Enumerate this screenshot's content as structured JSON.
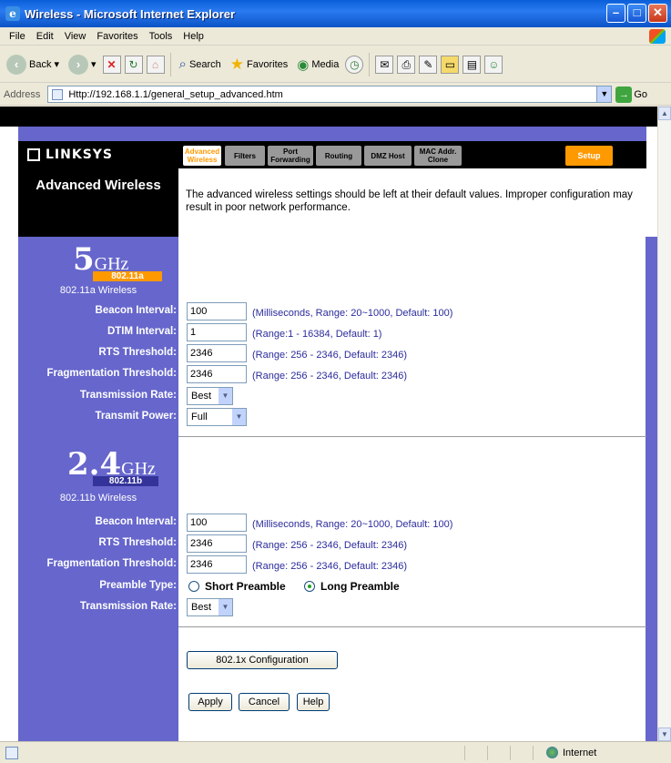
{
  "window": {
    "title": "Wireless - Microsoft Internet Explorer"
  },
  "menu": [
    "File",
    "Edit",
    "View",
    "Favorites",
    "Tools",
    "Help"
  ],
  "toolbar": {
    "back": "Back",
    "search": "Search",
    "favorites": "Favorites",
    "media": "Media"
  },
  "address": {
    "label": "Address",
    "url": "Http://192.168.1.1/general_setup_advanced.htm",
    "go": "Go"
  },
  "brand": {
    "logo": "LINKSYS"
  },
  "tabs": [
    {
      "label": "Advanced Wireless",
      "active": true
    },
    {
      "label": "Filters"
    },
    {
      "label": "Port Forwarding"
    },
    {
      "label": "Routing"
    },
    {
      "label": "DMZ Host"
    },
    {
      "label": "MAC Addr. Clone"
    },
    {
      "label": "Setup"
    }
  ],
  "section": {
    "title": "Advanced Wireless",
    "intro": "The advanced wireless settings should be left at their default values. Improper configuration may result in poor network performance."
  },
  "band_a": {
    "badge_num": "5",
    "badge_unit": "GHz",
    "badge_tag": "802.11a",
    "subtitle": "802.11a Wireless",
    "beacon": {
      "label": "Beacon Interval:",
      "value": "100",
      "hint": "(Milliseconds, Range: 20~1000, Default: 100)"
    },
    "dtim": {
      "label": "DTIM Interval:",
      "value": "1",
      "hint": "(Range:1 - 16384, Default: 1)"
    },
    "rts": {
      "label": "RTS Threshold:",
      "value": "2346",
      "hint": "(Range: 256 - 2346, Default: 2346)"
    },
    "frag": {
      "label": "Fragmentation Threshold:",
      "value": "2346",
      "hint": "(Range: 256 - 2346, Default: 2346)"
    },
    "rate": {
      "label": "Transmission Rate:",
      "value": "Best"
    },
    "power": {
      "label": "Transmit Power:",
      "value": "Full"
    }
  },
  "band_b": {
    "badge_num": "2.4",
    "badge_unit": "GHz",
    "badge_tag": "802.11b",
    "subtitle": "802.11b Wireless",
    "beacon": {
      "label": "Beacon Interval:",
      "value": "100",
      "hint": "(Milliseconds, Range: 20~1000, Default: 100)"
    },
    "rts": {
      "label": "RTS Threshold:",
      "value": "2346",
      "hint": "(Range: 256 - 2346, Default: 2346)"
    },
    "frag": {
      "label": "Fragmentation Threshold:",
      "value": "2346",
      "hint": "(Range: 256 - 2346, Default: 2346)"
    },
    "preamble": {
      "label": "Preamble Type:",
      "short": "Short Preamble",
      "long": "Long Preamble",
      "selected": "long"
    },
    "rate": {
      "label": "Transmission Rate:",
      "value": "Best"
    }
  },
  "buttons": {
    "dot1x": "802.1x Configuration",
    "apply": "Apply",
    "cancel": "Cancel",
    "help": "Help"
  },
  "status": {
    "zone": "Internet"
  },
  "colors": {
    "purple": "#6666cc",
    "orange": "#ff9900",
    "hint": "#2b2b9c"
  }
}
